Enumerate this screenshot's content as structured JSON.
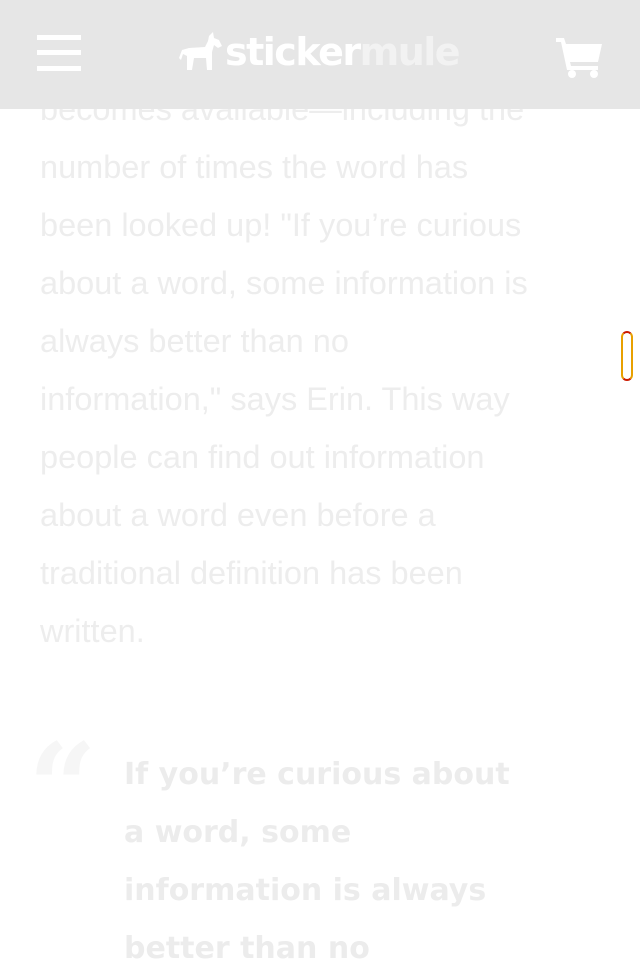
{
  "header": {
    "logo_text_main": "sticker",
    "logo_text_accent": "mule",
    "menu_icon": "hamburger-menu-icon",
    "cart_icon": "shopping-cart-icon",
    "logo_icon": "mule-icon",
    "background_color": "#e6e6e6"
  },
  "article": {
    "lines": [
      "becomes available—including the",
      "number of times the word has",
      "been looked up! \"If you’re curious",
      "about a word, some information is",
      "always better than no",
      "information,\" says Erin. This way",
      "people can find out information",
      "about a word even before a",
      "traditional definition has been",
      "written."
    ]
  },
  "pull_quote": {
    "mark": "“",
    "lines": [
      "If you’re curious about",
      "a word, some",
      "information is always",
      "better than no"
    ]
  }
}
